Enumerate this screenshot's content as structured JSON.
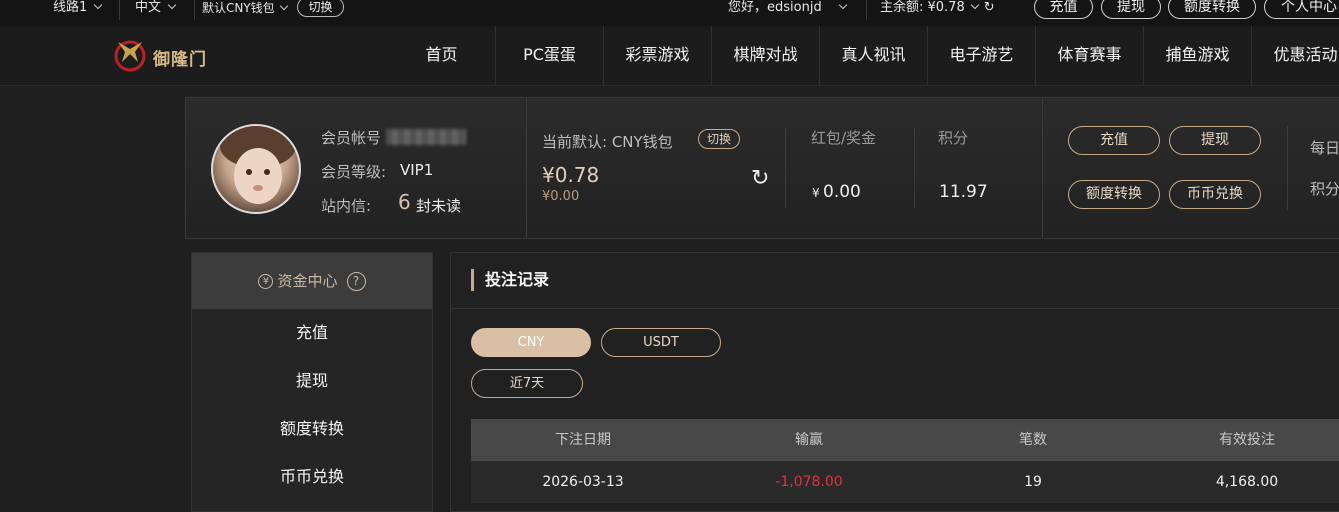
{
  "topbar": {
    "line_label": "线路1",
    "lang_label": "中文",
    "wallet_label": "默认CNY钱包",
    "switch_label": "切换",
    "greeting": "您好，edsionjd",
    "balance": "主余额: ¥0.78",
    "deposit": "充值",
    "withdraw": "提现",
    "transfer": "额度转换",
    "personal": "个人中心"
  },
  "logo": {
    "text": "御隆门"
  },
  "nav": [
    "首页",
    "PC蛋蛋",
    "彩票游戏",
    "棋牌对战",
    "真人视讯",
    "电子游艺",
    "体育赛事",
    "捕鱼游戏",
    "优惠活动"
  ],
  "profile": {
    "account_label": "会员帐号",
    "level_label": "会员等级:",
    "level_value": "VIP1",
    "inbox_label": "站内信:",
    "inbox_count": "6",
    "inbox_suffix": "封未读",
    "current_default_label": "当前默认: CNY钱包",
    "switch_label": "切换",
    "main_amount": "¥0.78",
    "sub_amount": "¥0.00",
    "bonus_label": "红包/奖金",
    "bonus_currency": "¥",
    "bonus_value": "0.00",
    "points_label": "积分",
    "points_value": "11.97",
    "btn_deposit": "充值",
    "btn_withdraw": "提现",
    "btn_transfer": "额度转换",
    "btn_exchange": "币币兑换",
    "daily_label": "每日",
    "points_label_2": "积分"
  },
  "sidebar": {
    "title": "资金中心",
    "items": [
      "充值",
      "提现",
      "额度转换",
      "币币兑换"
    ]
  },
  "main": {
    "title": "投注记录",
    "currency_tabs": [
      "CNY",
      "USDT"
    ],
    "range_button": "近7天",
    "columns": [
      "下注日期",
      "输赢",
      "笔数",
      "有效投注"
    ],
    "rows": [
      {
        "date": "2026-03-13",
        "winloss": "-1,078.00",
        "count": "19",
        "valid_bet": "4,168.00"
      }
    ]
  },
  "colors": {
    "accent": "#c7a98a",
    "negative": "#e0323a",
    "active_tab": "#d8bfa6"
  }
}
